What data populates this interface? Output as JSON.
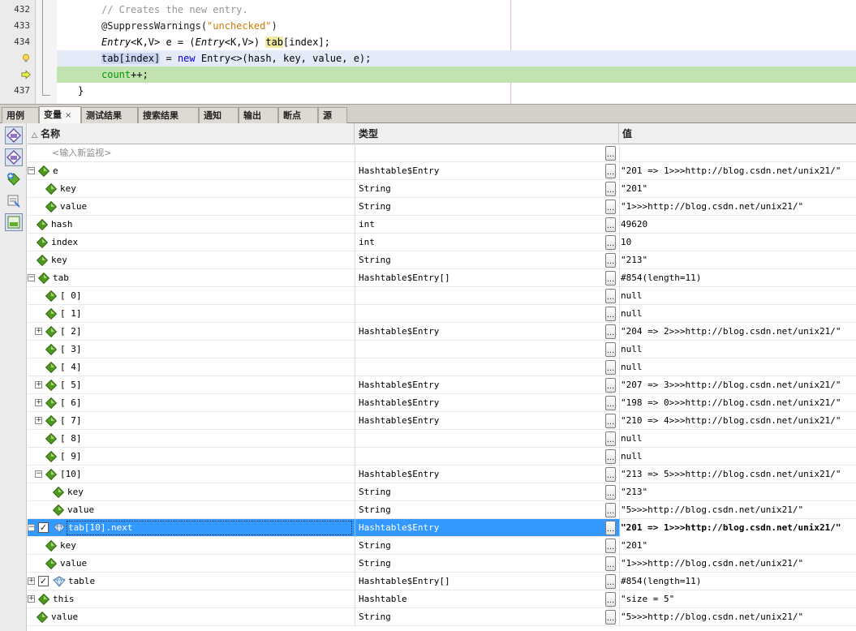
{
  "editor": {
    "lines": [
      {
        "num": "432",
        "parts": [
          [
            "comment",
            "// Creates the new entry."
          ]
        ]
      },
      {
        "num": "433",
        "parts": [
          [
            "ann",
            "@SuppressWarnings("
          ],
          [
            "str",
            "\"unchecked\""
          ],
          [
            "ann",
            ")"
          ]
        ]
      },
      {
        "num": "434",
        "parts": [
          [
            "it",
            "Entry"
          ],
          [
            "plain",
            "<K,V> e = ("
          ],
          [
            "it",
            "Entry"
          ],
          [
            "plain",
            "<K,V>) "
          ],
          [
            "mark",
            "tab"
          ],
          [
            "plain",
            "[index];"
          ]
        ]
      },
      {
        "num": "",
        "parts": [
          [
            "sel",
            "tab[index]"
          ],
          [
            "plain",
            " = "
          ],
          [
            "kw",
            "new"
          ],
          [
            "plain",
            " Entry<>(hash, key, value, e);"
          ]
        ]
      },
      {
        "num": "",
        "parts": [
          [
            "fld",
            "count"
          ],
          [
            "plain",
            "++;"
          ]
        ]
      },
      {
        "num": "437",
        "parts": [
          [
            "plain",
            "}"
          ]
        ]
      }
    ]
  },
  "tabs": [
    {
      "label": "用例",
      "active": false
    },
    {
      "label": "变量",
      "active": true,
      "close": "×"
    },
    {
      "label": "测试结果",
      "active": false
    },
    {
      "label": "搜索结果",
      "active": false
    },
    {
      "label": "通知",
      "active": false
    },
    {
      "label": "输出",
      "active": false
    },
    {
      "label": "断点",
      "active": false
    },
    {
      "label": "源",
      "active": false
    }
  ],
  "table": {
    "columns": {
      "name": "名称",
      "type": "类型",
      "value": "值"
    },
    "ellipsis": "...",
    "rows": [
      {
        "indent": 0,
        "toggle": "",
        "icon": "none",
        "name": "<输入新监视>",
        "placeholder": true,
        "type": "",
        "value": ""
      },
      {
        "indent": 0,
        "toggle": "−",
        "icon": "diamond",
        "name": "e",
        "type": "Hashtable$Entry",
        "value": "\"201 => 1>>>http://blog.csdn.net/unix21/\""
      },
      {
        "indent": 1,
        "toggle": "",
        "icon": "diamond",
        "name": "key",
        "type": "String",
        "value": "\"201\""
      },
      {
        "indent": 1,
        "toggle": "",
        "icon": "diamond",
        "name": "value",
        "type": "String",
        "value": "\"1>>>http://blog.csdn.net/unix21/\""
      },
      {
        "indent": 0,
        "toggle": "",
        "icon": "diamond",
        "name": "hash",
        "type": "int",
        "value": "49620"
      },
      {
        "indent": 0,
        "toggle": "",
        "icon": "diamond",
        "name": "index",
        "type": "int",
        "value": "10"
      },
      {
        "indent": 0,
        "toggle": "",
        "icon": "diamond",
        "name": "key",
        "type": "String",
        "value": "\"213\""
      },
      {
        "indent": 0,
        "toggle": "−",
        "icon": "diamond",
        "name": "tab",
        "type": "Hashtable$Entry[]",
        "value": "#854(length=11)"
      },
      {
        "indent": 1,
        "toggle": "",
        "icon": "diamond",
        "name": "[ 0]",
        "type": "",
        "value": "null"
      },
      {
        "indent": 1,
        "toggle": "",
        "icon": "diamond",
        "name": "[ 1]",
        "type": "",
        "value": "null"
      },
      {
        "indent": 1,
        "toggle": "+",
        "icon": "diamond",
        "name": "[ 2]",
        "type": "Hashtable$Entry",
        "value": "\"204 => 2>>>http://blog.csdn.net/unix21/\""
      },
      {
        "indent": 1,
        "toggle": "",
        "icon": "diamond",
        "name": "[ 3]",
        "type": "",
        "value": "null"
      },
      {
        "indent": 1,
        "toggle": "",
        "icon": "diamond",
        "name": "[ 4]",
        "type": "",
        "value": "null"
      },
      {
        "indent": 1,
        "toggle": "+",
        "icon": "diamond",
        "name": "[ 5]",
        "type": "Hashtable$Entry",
        "value": "\"207 => 3>>>http://blog.csdn.net/unix21/\""
      },
      {
        "indent": 1,
        "toggle": "+",
        "icon": "diamond",
        "name": "[ 6]",
        "type": "Hashtable$Entry",
        "value": "\"198 => 0>>>http://blog.csdn.net/unix21/\""
      },
      {
        "indent": 1,
        "toggle": "+",
        "icon": "diamond",
        "name": "[ 7]",
        "type": "Hashtable$Entry",
        "value": "\"210 => 4>>>http://blog.csdn.net/unix21/\""
      },
      {
        "indent": 1,
        "toggle": "",
        "icon": "diamond",
        "name": "[ 8]",
        "type": "",
        "value": "null"
      },
      {
        "indent": 1,
        "toggle": "",
        "icon": "diamond",
        "name": "[ 9]",
        "type": "",
        "value": "null"
      },
      {
        "indent": 1,
        "toggle": "−",
        "icon": "diamond",
        "name": "[10]",
        "type": "Hashtable$Entry",
        "value": "\"213 => 5>>>http://blog.csdn.net/unix21/\""
      },
      {
        "indent": 2,
        "toggle": "",
        "icon": "diamond",
        "name": "key",
        "type": "String",
        "value": "\"213\""
      },
      {
        "indent": 2,
        "toggle": "",
        "icon": "diamond",
        "name": "value",
        "type": "String",
        "value": "\"5>>>http://blog.csdn.net/unix21/\""
      },
      {
        "indent": 0,
        "toggle": "−",
        "icon": "watch",
        "check": "✓",
        "name": "tab[10].next",
        "type": "Hashtable$Entry",
        "value": "\"201 => 1>>>http://blog.csdn.net/unix21/\"",
        "selected": true
      },
      {
        "indent": 1,
        "toggle": "",
        "icon": "diamond",
        "name": "key",
        "type": "String",
        "value": "\"201\""
      },
      {
        "indent": 1,
        "toggle": "",
        "icon": "diamond",
        "name": "value",
        "type": "String",
        "value": "\"1>>>http://blog.csdn.net/unix21/\""
      },
      {
        "indent": 0,
        "toggle": "+",
        "icon": "watch",
        "check": "✓",
        "name": "table",
        "type": "Hashtable$Entry[]",
        "value": "#854(length=11)"
      },
      {
        "indent": 0,
        "toggle": "+",
        "icon": "diamond",
        "name": "this",
        "type": "Hashtable",
        "value": "\"size = 5\""
      },
      {
        "indent": 0,
        "toggle": "",
        "icon": "diamond",
        "name": "value",
        "type": "String",
        "value": "\"5>>>http://blog.csdn.net/unix21/\""
      }
    ]
  },
  "colors": {
    "selection": "#3399ff",
    "current_line": "#c2e3b0",
    "diamond": "#4f9a1e"
  }
}
